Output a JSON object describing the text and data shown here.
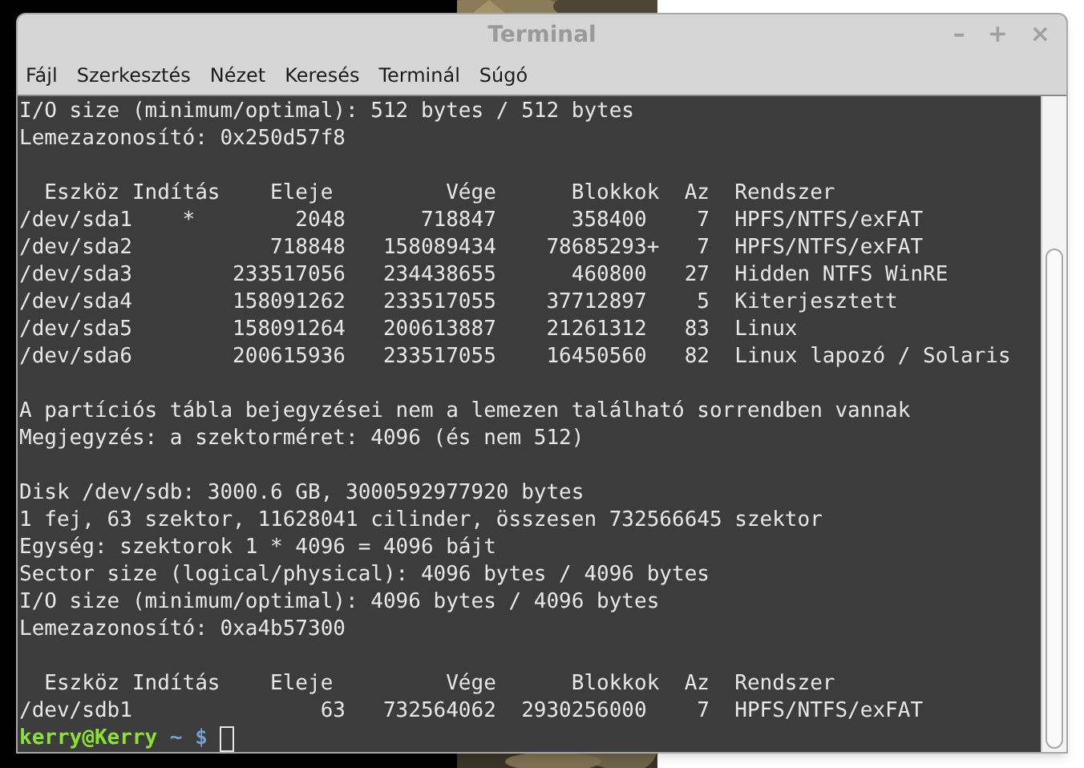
{
  "window": {
    "title": "Terminal",
    "controls": [
      "–",
      "+",
      "×"
    ]
  },
  "menu": [
    "Fájl",
    "Szerkesztés",
    "Nézet",
    "Keresés",
    "Terminál",
    "Súgó"
  ],
  "terminal": {
    "blocks": [
      [
        "I/O size (minimum/optimal): 512 bytes / 512 bytes",
        "Lemezazonosító: 0x250d57f8"
      ],
      [
        "  Eszköz Indítás    Eleje         Vége      Blokkok  Az  Rendszer",
        "/dev/sda1    *        2048      718847      358400    7  HPFS/NTFS/exFAT",
        "/dev/sda2           718848   158089434    78685293+   7  HPFS/NTFS/exFAT",
        "/dev/sda3        233517056   234438655      460800   27  Hidden NTFS WinRE",
        "/dev/sda4        158091262   233517055    37712897    5  Kiterjesztett",
        "/dev/sda5        158091264   200613887    21261312   83  Linux",
        "/dev/sda6        200615936   233517055    16450560   82  Linux lapozó / Solaris"
      ],
      [
        "A partíciós tábla bejegyzései nem a lemezen található sorrendben vannak",
        "Megjegyzés: a szektorméret: 4096 (és nem 512)"
      ],
      [
        "Disk /dev/sdb: 3000.6 GB, 3000592977920 bytes",
        "1 fej, 63 szektor, 11628041 cilinder, összesen 732566645 szektor",
        "Egység: szektorok 1 * 4096 = 4096 bájt",
        "Sector size (logical/physical): 4096 bytes / 4096 bytes",
        "I/O size (minimum/optimal): 4096 bytes / 4096 bytes",
        "Lemezazonosító: 0xa4b57300"
      ],
      [
        "  Eszköz Indítás    Eleje         Vége      Blokkok  Az  Rendszer",
        "/dev/sdb1               63   732564062  2930256000    7  HPFS/NTFS/exFAT"
      ]
    ],
    "prompt": {
      "user_host": "kerry@Kerry",
      "path": "~",
      "symbol": "$"
    }
  }
}
